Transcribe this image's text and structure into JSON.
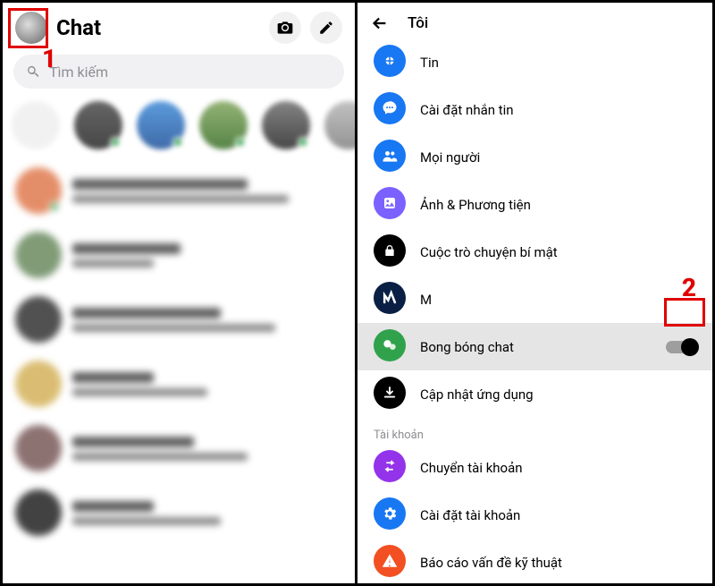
{
  "callouts": {
    "one": "1",
    "two": "2"
  },
  "left": {
    "title": "Chat",
    "search_placeholder": "Tìm kiếm"
  },
  "right": {
    "title": "Tôi",
    "items": [
      {
        "label": "Tin"
      },
      {
        "label": "Cài đặt nhắn tin"
      },
      {
        "label": "Mọi người"
      },
      {
        "label": "Ảnh & Phương tiện"
      },
      {
        "label": "Cuộc trò chuyện bí mật"
      },
      {
        "label": "M"
      },
      {
        "label": "Bong bóng chat"
      },
      {
        "label": "Cập nhật ứng dụng"
      }
    ],
    "section_account": "Tài khoản",
    "account_items": [
      {
        "label": "Chuyển tài khoản"
      },
      {
        "label": "Cài đặt tài khoản"
      },
      {
        "label": "Báo cáo vấn đề kỹ thuật"
      }
    ]
  }
}
